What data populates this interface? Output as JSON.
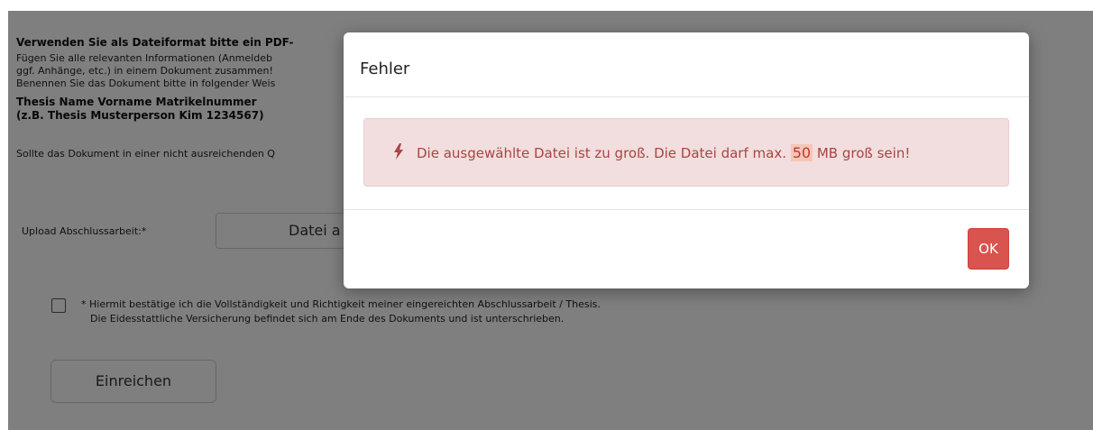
{
  "form": {
    "heading": "Verwenden Sie als Dateiformat bitte ein PDF-",
    "info_line_1": "Fügen Sie alle relevanten Informationen (Anmeldeb",
    "info_line_2": "ggf. Anhänge, etc.) in einem Dokument zusammen!",
    "info_line_3": "Benennen Sie das Dokument bitte in folgender Weis",
    "naming_line_1": "Thesis Name Vorname Matrikelnummer",
    "naming_line_2": "(z.B. Thesis Musterperson Kim 1234567)",
    "quality_line": "Sollte das Dokument in einer nicht ausreichenden Q",
    "upload_label": "Upload Abschlussarbeit:*",
    "upload_button_label": "Datei a",
    "confirm_line_1": "* Hiermit bestätige ich die Vollständigkeit und Richtigkeit meiner eingereichten Abschlussarbeit / Thesis.",
    "confirm_line_2": "Die Eidesstattliche Versicherung befindet sich am Ende des Dokuments und ist unterschrieben.",
    "submit_label": "Einreichen"
  },
  "dialog": {
    "title": "Fehler",
    "message_before": "Die ausgewählte Datei ist zu groß. Die Datei darf max. ",
    "max_size": "50",
    "message_after": " MB groß sein!",
    "icon": "bolt-icon",
    "ok_label": "OK"
  },
  "colors": {
    "alert_background": "#f2dede",
    "alert_text": "#a94442",
    "ok_button": "#d9534f"
  }
}
